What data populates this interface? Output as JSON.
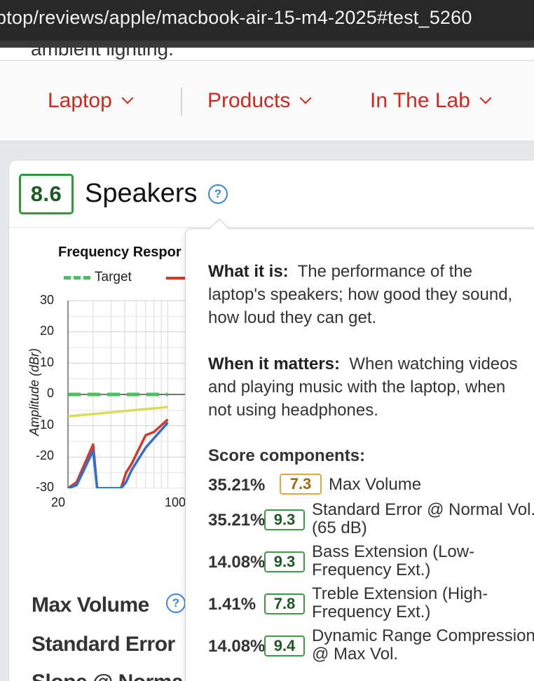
{
  "browser": {
    "url": "ptop/reviews/apple/macbook-air-15-m4-2025#test_5260"
  },
  "page_peek": {
    "text": "ambient lighting."
  },
  "nav": {
    "items": [
      {
        "label": "Laptop"
      },
      {
        "label": "Products"
      },
      {
        "label": "In The Lab"
      }
    ]
  },
  "card": {
    "score": "8.6",
    "title": "Speakers",
    "help_icon": "question-circle-icon"
  },
  "chart": {
    "title": "Frequency Respor",
    "legend_target": "Target",
    "yaxis_title": "Amplitude (dBr)",
    "y_ticks": [
      "30",
      "20",
      "10",
      "0",
      "-10",
      "-20",
      "-30"
    ],
    "x_ticks": [
      "20",
      "100"
    ]
  },
  "chart_data": {
    "type": "line",
    "title": "Frequency Respor",
    "ylabel": "Amplitude (dBr)",
    "ylim": [
      -30,
      30
    ],
    "x_scale": "log",
    "series": [
      {
        "name": "Target",
        "color": "#4cbf63",
        "style": "dashed",
        "x": [
          20,
          100
        ],
        "values": [
          0,
          0
        ]
      },
      {
        "color": "#d03a2c",
        "x": [
          20,
          23,
          30,
          32,
          47,
          51,
          56,
          70,
          80,
          100
        ],
        "values": [
          -30,
          -28,
          -16,
          -30,
          -30,
          -25,
          -22,
          -13,
          -12,
          -8
        ]
      },
      {
        "color": "#2f6fd0",
        "x": [
          20,
          23,
          30,
          32,
          47,
          51,
          56,
          70,
          80,
          100
        ],
        "values": [
          -30,
          -29,
          -18,
          -30,
          -30,
          -28,
          -24,
          -17,
          -14,
          -9
        ]
      },
      {
        "color": "#d9dc5a",
        "x": [
          20,
          100
        ],
        "values": [
          -7,
          -4
        ]
      }
    ]
  },
  "metrics": [
    {
      "label": "Max Volume"
    },
    {
      "label": "Standard Error"
    },
    {
      "label": "Slope @ Norma"
    }
  ],
  "tooltip": {
    "what_label": "What it is:",
    "what_text": "The performance of the laptop's speakers; how good they sound, how loud they can get.",
    "when_label": "When it matters:",
    "when_text": "When watching videos and playing music with the laptop, when not using headphones.",
    "components_heading": "Score components:",
    "components": [
      {
        "weight": "35.21%",
        "score": "7.3",
        "name": "Max Volume",
        "badge_color": "#e6a63a"
      },
      {
        "weight": "35.21%",
        "score": "9.3",
        "name": "Standard Error @ Normal Vol. (65 dB)",
        "badge_color": "#3c9c46"
      },
      {
        "weight": "14.08%",
        "score": "9.3",
        "name": "Bass Extension (Low-Frequency Ext.)",
        "badge_color": "#3c9c46"
      },
      {
        "weight": "1.41%",
        "score": "7.8",
        "name": "Treble Extension (High-Frequency Ext.)",
        "badge_color": "#3c9c46"
      },
      {
        "weight": "14.08%",
        "score": "9.4",
        "name": "Dynamic Range Compression @ Max Vol.",
        "badge_color": "#3c9c46"
      }
    ]
  }
}
